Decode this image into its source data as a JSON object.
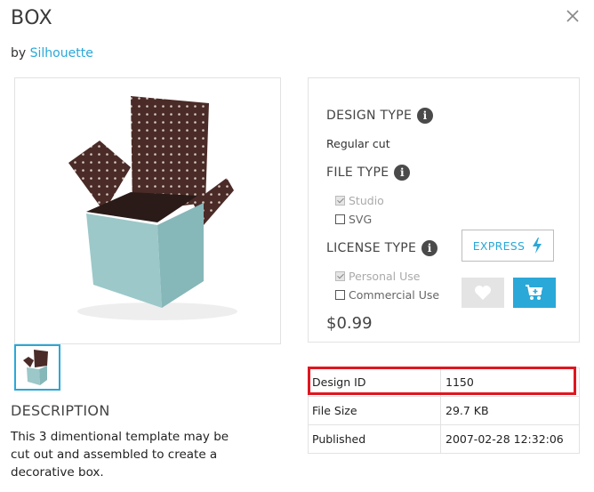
{
  "header": {
    "title": "BOX",
    "by_prefix": "by",
    "author": "Silhouette"
  },
  "icons": {
    "close": "close-icon",
    "info": "info-icon",
    "express": "lightning-icon",
    "favorite": "heart-icon",
    "cart": "cart-icon"
  },
  "colors": {
    "accent": "#2aa8d8",
    "highlight": "#e0161f",
    "box_teal": "#9cc8c9",
    "box_brown": "#4a2b27"
  },
  "details": {
    "design_type_label": "DESIGN TYPE",
    "design_type_value": "Regular cut",
    "file_type_label": "FILE TYPE",
    "file_types": [
      {
        "label": "Studio",
        "checked": true,
        "disabled": true
      },
      {
        "label": "SVG",
        "checked": false,
        "disabled": false
      }
    ],
    "license_type_label": "LICENSE TYPE",
    "license_types": [
      {
        "label": "Personal Use",
        "checked": true,
        "disabled": true
      },
      {
        "label": "Commercial Use",
        "checked": false,
        "disabled": false
      }
    ],
    "price": "$0.99",
    "express_label": "EXPRESS"
  },
  "description": {
    "heading": "DESCRIPTION",
    "text": "This 3 dimentional template may be cut out and assembled to create a decorative box."
  },
  "meta_table": [
    {
      "label": "Design ID",
      "value": "1150",
      "highlighted": true
    },
    {
      "label": "File Size",
      "value": "29.7 KB",
      "highlighted": false
    },
    {
      "label": "Published",
      "value": "2007-02-28 12:32:06",
      "highlighted": false
    }
  ]
}
